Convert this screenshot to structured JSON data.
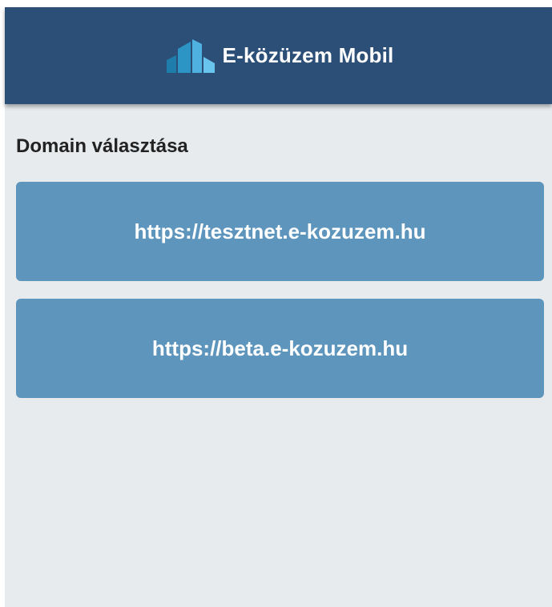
{
  "header": {
    "title": "E-közüzem Mobil",
    "logo_icon": "building-bars-icon",
    "background_color": "#2c4f78"
  },
  "main": {
    "section_title": "Domain választása",
    "domains": [
      {
        "label": "https://tesztnet.e-kozuzem.hu"
      },
      {
        "label": "https://beta.e-kozuzem.hu"
      }
    ],
    "button_color": "#5e95bd",
    "background_color": "#e7ebee"
  }
}
